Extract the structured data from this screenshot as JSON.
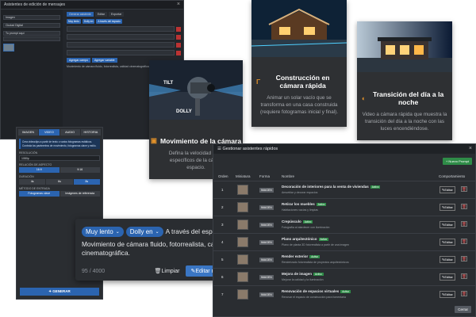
{
  "assistant_window": {
    "title": "Asistentes de edición de mensajes",
    "fields": [
      "Imagen",
      "Ciudad Digital",
      "Tu prompt aquí"
    ],
    "tabs": [
      "Generar asistente",
      "Editar",
      "Exportar"
    ],
    "chips": [
      "Muy lento",
      "Dolly en",
      "A través del espacio"
    ],
    "buttons": [
      "Agregar campo",
      "Agregar variable"
    ],
    "note": "Movimiento de cámara fluido, fotorrealista, calidad cinematográfica."
  },
  "cards": [
    {
      "icon": "camera-icon",
      "title": "Movimiento de la cámara",
      "desc": "Defina la velocidad y el t\nespecíficos de la cámar\nespacio.",
      "img_labels": [
        "TILT",
        "DOLLY"
      ]
    },
    {
      "icon": "construction-icon",
      "title": "Construcción en cámara rápida",
      "desc": "Animar un solar vacío que se transforma en una casa construida (requiere fotogramas inicial y final)."
    },
    {
      "icon": "daynight-icon",
      "title": "Transición del día a la noche",
      "desc": "Video a cámara rápida que muestra la transición del día a la noche con las luces encendiéndose."
    }
  ],
  "generator": {
    "tabs": [
      "IMAGEN",
      "VIDEO",
      "AUDIO",
      "HISTORIA"
    ],
    "info": "Crea videoclips a partir de texto o varios fotogramas estáticos. Controla los parámetros de movimiento, fotogramas clave y estilo.",
    "res_label": "RESOLUCIÓN",
    "res_value": "1080p",
    "ratio_label": "RELACIÓN DE ASPECTO",
    "ratios": [
      "16:9",
      "9:16"
    ],
    "duration_label": "DURACIÓN",
    "durations": [
      "4s",
      "6s",
      "8s"
    ],
    "method_label": "MÉTODO DE ENTRADA",
    "methods": [
      "Fotogramas clave",
      "Imágenes de referencia"
    ],
    "generate": "GENERAR"
  },
  "editor": {
    "pills": [
      "Muy lento",
      "Dolly en"
    ],
    "lead_text": "A través del espacio.",
    "body_text": "Movimiento de cámara fluido, fotorrealista, calidad cinematográfica.",
    "counter": "95 / 4000",
    "clear_label": "Limpiar",
    "edit_label": "Editar manualmente"
  },
  "manage": {
    "title": "Gestionar asistentes rápidos",
    "new_button": "+ Nuevo Prompt",
    "columns": [
      "Orden",
      "Miniatura",
      "Forma",
      "Nombre",
      "Comportamiento"
    ],
    "active_label": "Activo",
    "form_label": "IMAGEN",
    "edit_label": "Editar",
    "rows": [
      {
        "n": "1",
        "name": "Decoración de interiores para la venta de viviendas",
        "sub": "Amueblar y decorar espacios"
      },
      {
        "n": "2",
        "name": "Retirar los muebles",
        "sub": "Habitaciones vacías y limpias"
      },
      {
        "n": "3",
        "name": "Crepúsculo",
        "sub": "Fotografía al atardecer con iluminación"
      },
      {
        "n": "4",
        "name": "Plano arquitectónico",
        "sub": "Plano de planta 3D fotorrealista a partir de una imagen"
      },
      {
        "n": "5",
        "name": "Render exterior",
        "sub": "Renderizado fotorrealista de proyectos arquitectónicos"
      },
      {
        "n": "6",
        "name": "Mejora de imagen",
        "sub": "Mejorar la calidad y la iluminación"
      },
      {
        "n": "7",
        "name": "Renovación de espacios virtuales",
        "sub": "Renovar el espacio de construcción para fomentarla"
      }
    ],
    "close_label": "Cerrar"
  }
}
